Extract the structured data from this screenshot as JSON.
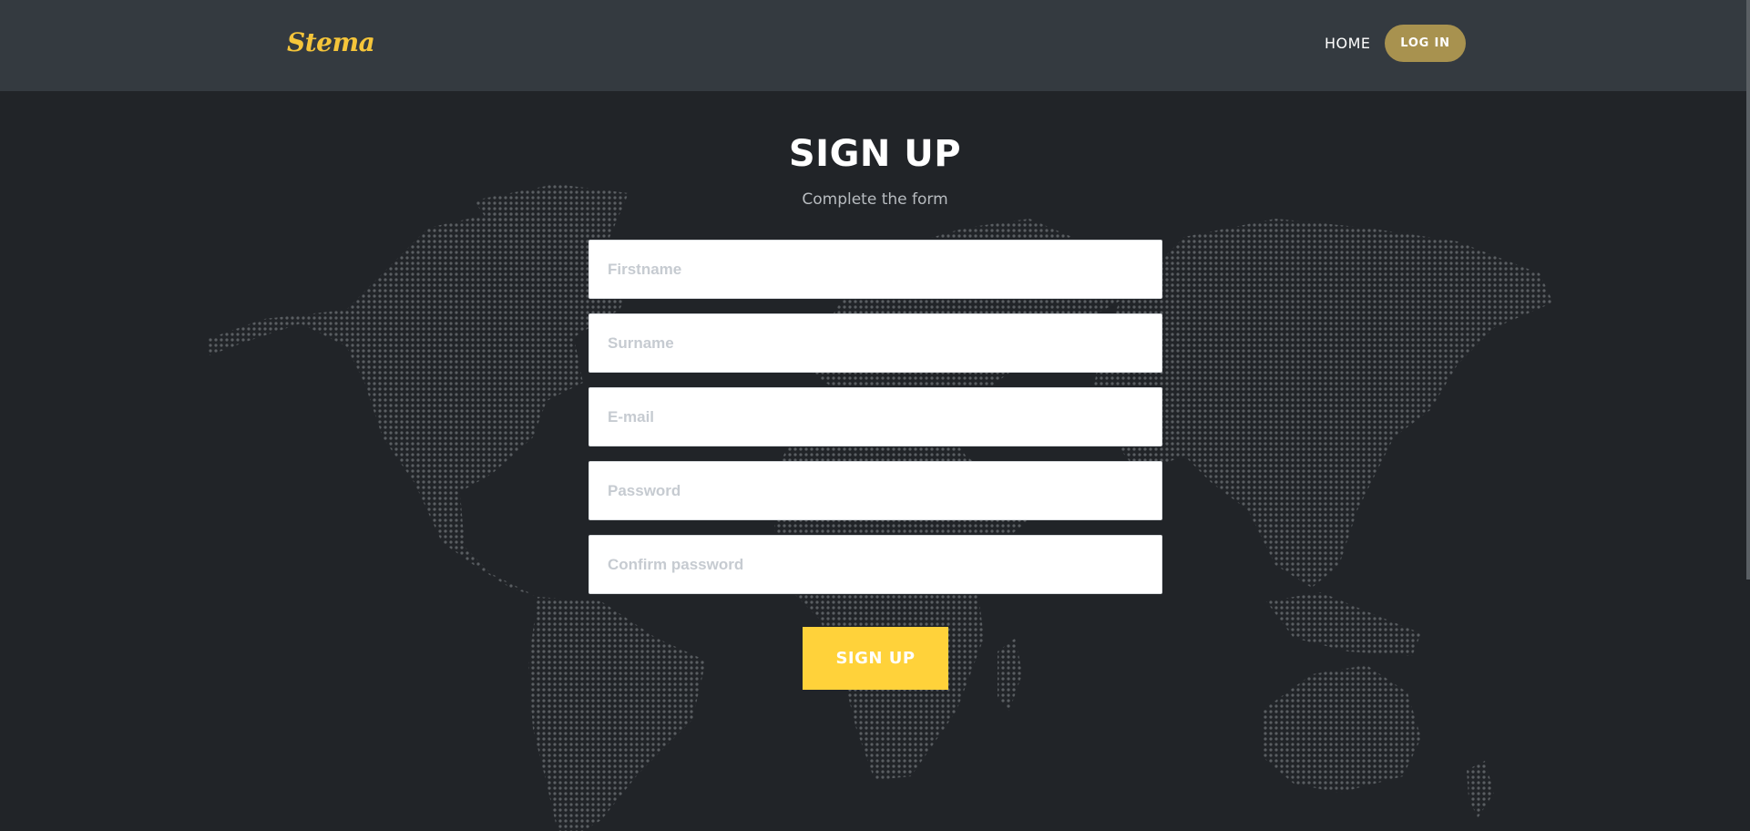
{
  "header": {
    "brand": "Stema",
    "nav": {
      "home": "HOME",
      "login": "LOG IN"
    }
  },
  "main": {
    "title": "SIGN UP",
    "subtitle": "Complete the form",
    "fields": [
      {
        "placeholder": "Firstname",
        "value": ""
      },
      {
        "placeholder": "Surname",
        "value": ""
      },
      {
        "placeholder": "E-mail",
        "value": ""
      },
      {
        "placeholder": "Password",
        "value": ""
      },
      {
        "placeholder": "Confirm password",
        "value": ""
      }
    ],
    "submit_label": "SIGN UP"
  },
  "colors": {
    "background": "#212428",
    "header": "#343a40",
    "brand": "#f5c53a",
    "login_button": "#a8924f",
    "submit_button": "#ffd23a",
    "map_dots": "#5a5e62"
  },
  "icons": {
    "background": "world-map-dots"
  }
}
